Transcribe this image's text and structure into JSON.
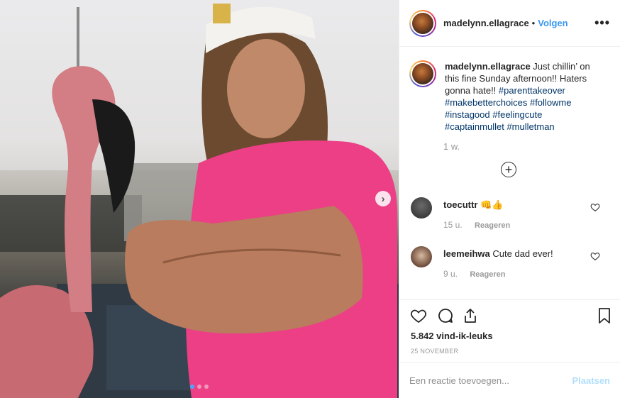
{
  "header": {
    "username": "madelynn.ellagrace",
    "separator": "•",
    "follow_label": "Volgen",
    "more_label": "•••"
  },
  "photo": {
    "next_label": "›",
    "slide_count": 3,
    "active_slide": 1
  },
  "caption": {
    "username": "madelynn.ellagrace",
    "text": "Just chillin’ on this fine Sunday afternoon!! Haters gonna hate!!",
    "hashtags": [
      "#parenttakeover",
      "#makebetterchoices",
      "#followme",
      "#instagood",
      "#feelingcute",
      "#captainmullet",
      "#mulletman"
    ],
    "time": "1 w."
  },
  "load_more_label": "+",
  "comments": [
    {
      "username": "toecuttr",
      "text": "👊👍",
      "time": "15 u.",
      "reply_label": "Reageren"
    },
    {
      "username": "leemeihwa",
      "text": "Cute dad ever!",
      "time": "9 u.",
      "reply_label": "Reageren"
    }
  ],
  "likes": "5.842 vind-ik-leuks",
  "date": "25 NOVEMBER",
  "add_comment": {
    "placeholder": "Een reactie toevoegen...",
    "post_label": "Plaatsen"
  }
}
